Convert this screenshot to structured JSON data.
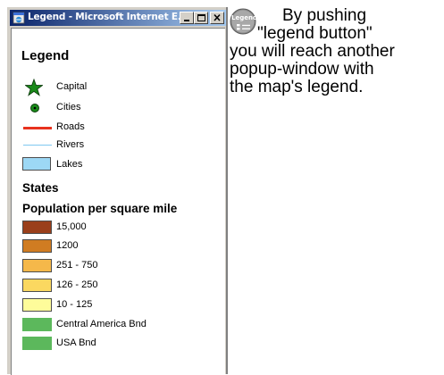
{
  "window": {
    "title": "Legend - Microsoft Internet E...",
    "buttons": [
      "minimize",
      "maximize",
      "close"
    ]
  },
  "legend": {
    "title": "Legend",
    "features": [
      {
        "label": "Capital",
        "symbol": "star",
        "color": "#1a8a1a"
      },
      {
        "label": "Cities",
        "symbol": "dot",
        "color": "#1a8a1a"
      },
      {
        "label": "Roads",
        "symbol": "line",
        "color": "#e8321e"
      },
      {
        "label": "Rivers",
        "symbol": "line",
        "color": "#7ec8f0"
      },
      {
        "label": "Lakes",
        "symbol": "box",
        "color": "#9dd8f5"
      }
    ],
    "states_heading": "States",
    "population_heading": "Population per square mile",
    "classes": [
      {
        "label": "15,000",
        "color": "#9a3f1b"
      },
      {
        "label": "1200",
        "color": "#d07c22"
      },
      {
        "label": "251 - 750",
        "color": "#f5b84a"
      },
      {
        "label": "126 - 250",
        "color": "#fbd860"
      },
      {
        "label": "10 - 125",
        "color": "#fefc9a"
      },
      {
        "label": "Central America Bnd",
        "color": "#5cb85c"
      },
      {
        "label": "USA Bnd",
        "color": "#5cb85c"
      }
    ]
  },
  "legend_button": {
    "text": "Legend"
  },
  "explanation": {
    "lines": [
      "By pushing",
      "\"legend button\"",
      "you will reach another",
      "popup-window with",
      "the map's legend."
    ]
  }
}
